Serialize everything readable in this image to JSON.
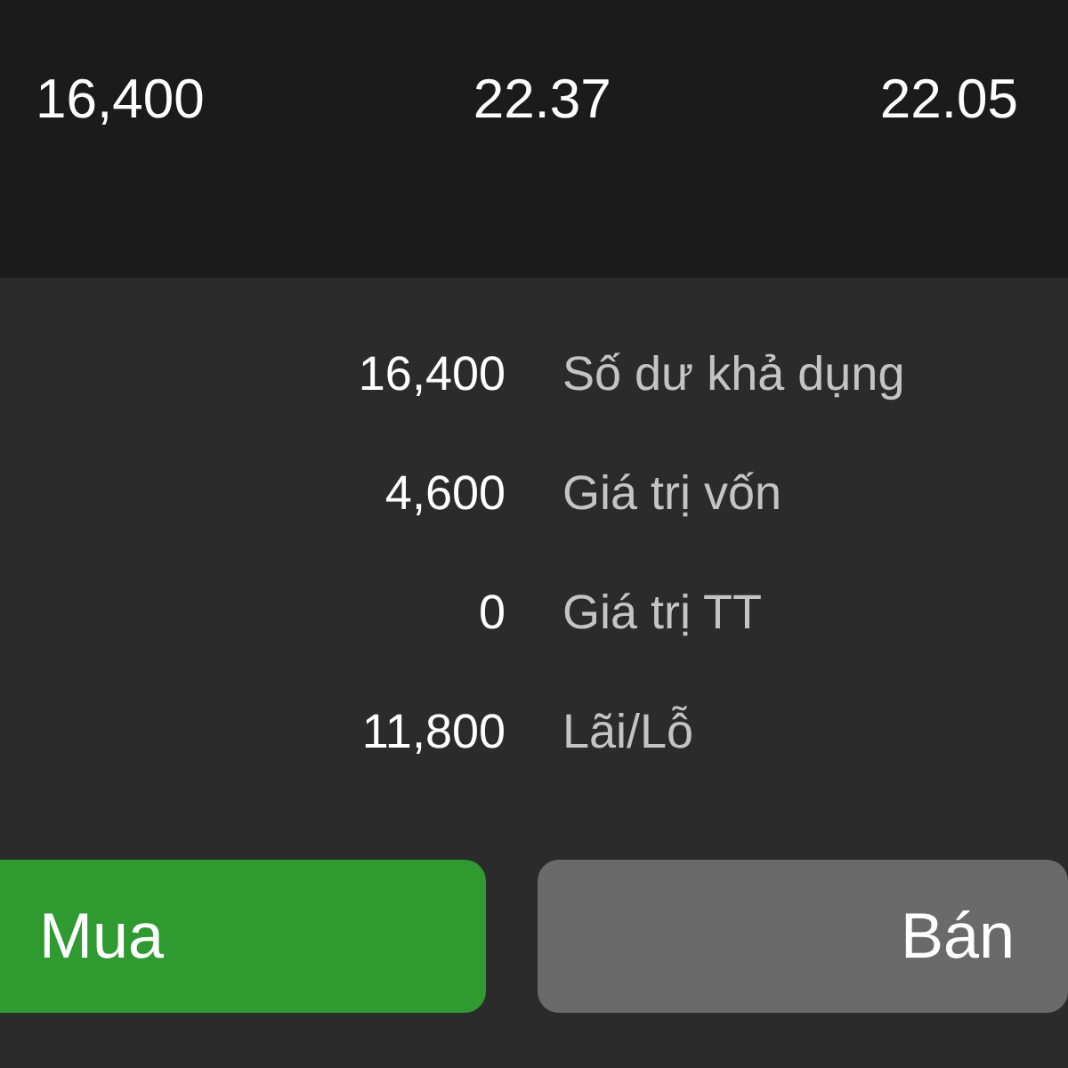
{
  "prices": [
    "16,400",
    "22.37",
    "22.05"
  ],
  "summary": [
    {
      "value": "16,400",
      "label": "Số dư khả dụng"
    },
    {
      "value": "4,600",
      "label": "Giá trị vốn"
    },
    {
      "value": "0",
      "label": "Giá trị TT"
    },
    {
      "value": "11,800",
      "label": "Lãi/Lỗ"
    }
  ],
  "buttons": [
    {
      "label": "Mua",
      "kind": "buy"
    },
    {
      "label": "Bán",
      "kind": "sell"
    }
  ]
}
